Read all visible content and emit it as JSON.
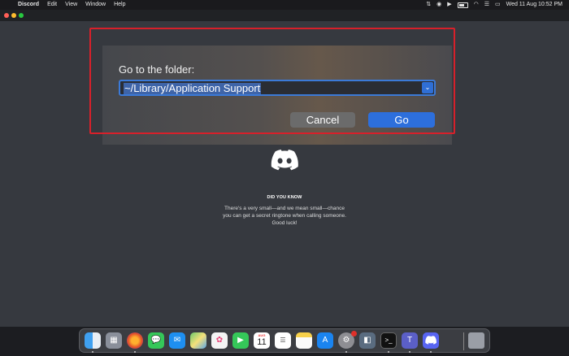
{
  "menubar": {
    "app_name": "Discord",
    "menus": [
      "Edit",
      "View",
      "Window",
      "Help"
    ],
    "clock": "Wed 11 Aug  10:52 PM"
  },
  "goto_dialog": {
    "label": "Go to the folder:",
    "path_value": "~/Library/Application Support",
    "cancel_label": "Cancel",
    "go_label": "Go"
  },
  "discord_splash": {
    "heading": "DID YOU KNOW",
    "tip": "There's a very small—and we mean small—chance you can get a secret ringtone when calling someone. Good luck!"
  },
  "dock": {
    "calendar_month": "AUG",
    "calendar_day": "11",
    "apps": [
      "finder",
      "launchpad",
      "firefox",
      "messages",
      "mail",
      "maps",
      "photos",
      "facetime",
      "calendar",
      "reminders",
      "notes",
      "app-store",
      "system-preferences",
      "preview",
      "terminal",
      "teams",
      "discord",
      "trash"
    ]
  },
  "colors": {
    "highlight_border": "#d8202a",
    "go_button": "#2d6fdc",
    "discord_background": "#36393f"
  }
}
